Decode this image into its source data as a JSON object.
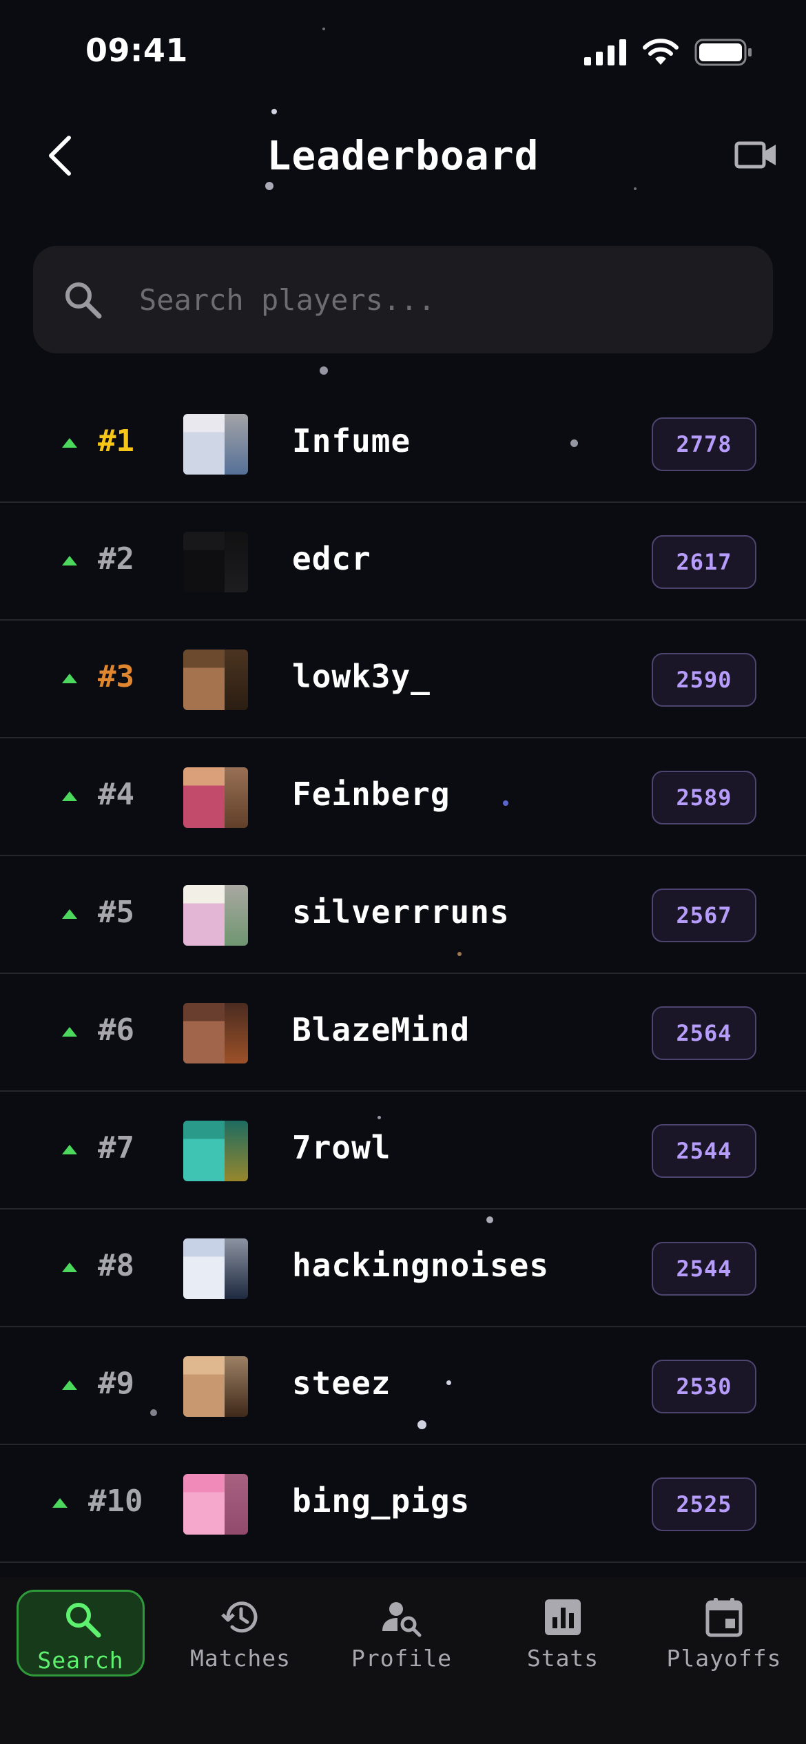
{
  "status_bar": {
    "time": "09:41"
  },
  "header": {
    "title": "Leaderboard"
  },
  "search": {
    "placeholder": "Search players..."
  },
  "colors": {
    "background": "#0b0b12",
    "trend_up": "#4bd85d",
    "rank_gold": "#f5c518",
    "rank_bronze": "#e0862f",
    "rank_default": "#a6a6ac",
    "elo_text": "#b79dfb",
    "active_tab": "#5ef06f"
  },
  "players": [
    {
      "rank": "#1",
      "name": "Infume",
      "elo": "2778",
      "trend": "up"
    },
    {
      "rank": "#2",
      "name": "edcr",
      "elo": "2617",
      "trend": "up"
    },
    {
      "rank": "#3",
      "name": "lowk3y_",
      "elo": "2590",
      "trend": "up"
    },
    {
      "rank": "#4",
      "name": "Feinberg",
      "elo": "2589",
      "trend": "up"
    },
    {
      "rank": "#5",
      "name": "silverrruns",
      "elo": "2567",
      "trend": "up"
    },
    {
      "rank": "#6",
      "name": "BlazeMind",
      "elo": "2564",
      "trend": "up"
    },
    {
      "rank": "#7",
      "name": "7rowl",
      "elo": "2544",
      "trend": "up"
    },
    {
      "rank": "#8",
      "name": "hackingnoises",
      "elo": "2544",
      "trend": "up"
    },
    {
      "rank": "#9",
      "name": "steez",
      "elo": "2530",
      "trend": "up"
    },
    {
      "rank": "#10",
      "name": "bing_pigs",
      "elo": "2525",
      "trend": "up"
    }
  ],
  "tabs": [
    {
      "label": "Search",
      "icon": "search-icon",
      "active": true
    },
    {
      "label": "Matches",
      "icon": "history-icon",
      "active": false
    },
    {
      "label": "Profile",
      "icon": "person-search-icon",
      "active": false
    },
    {
      "label": "Stats",
      "icon": "bar-chart-icon",
      "active": false
    },
    {
      "label": "Playoffs",
      "icon": "calendar-icon",
      "active": false
    }
  ]
}
